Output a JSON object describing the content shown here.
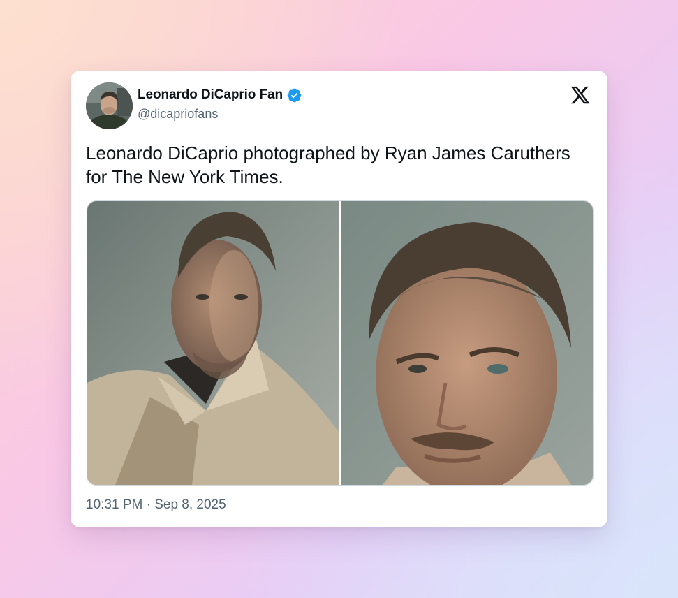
{
  "tweet": {
    "display_name": "Leonardo DiCaprio Fan",
    "handle": "@dicapriofans",
    "verified": true,
    "text": "Leonardo DiCaprio photographed by Ryan James Caruthers for The New York Times.",
    "timestamp": "10:31 PM · Sep 8, 2025",
    "media_count": 2
  },
  "icons": {
    "verified": "verified-badge-icon",
    "platform": "x-logo-icon"
  },
  "colors": {
    "text_primary": "#0f1419",
    "text_secondary": "#536471",
    "verified_blue": "#1d9bf0",
    "card_background": "#ffffff"
  }
}
